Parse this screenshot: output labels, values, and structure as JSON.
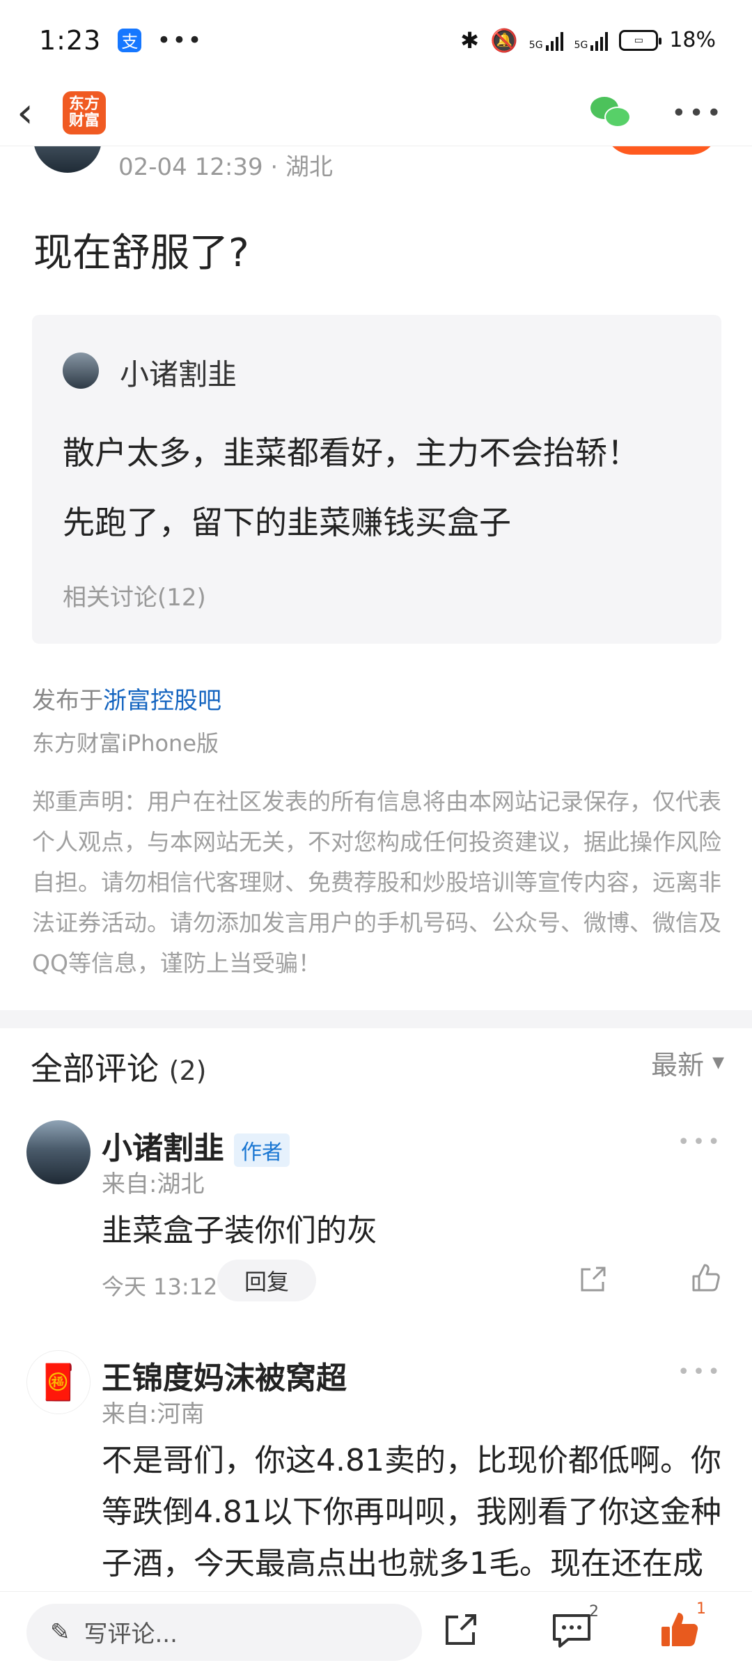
{
  "status_bar": {
    "time": "1:23",
    "alipay_icon": "支",
    "dots": "•••",
    "battery": "18%",
    "net_label_1": "5G",
    "net_label_2": "5G"
  },
  "nav": {
    "logo_text_top": "东方",
    "logo_text_bottom": "财富",
    "icons": [
      "back-icon",
      "wechat-icon",
      "more-icon"
    ]
  },
  "post": {
    "meta": "02-04 12:39 · 湖北",
    "title": "现在舒服了?",
    "quote": {
      "author": "小诸割韭",
      "line1": "散户太多，韭菜都看好，主力不会抬轿！",
      "line2": "先跑了，留下的韭菜赚钱买盒子",
      "related": "相关讨论(12)"
    },
    "publish_prefix": "发布于",
    "publish_link": "浙富控股吧",
    "client": "东方财富iPhone版",
    "disclaimer": "郑重声明：用户在社区发表的所有信息将由本网站记录保存，仅代表个人观点，与本网站无关，不对您构成任何投资建议，据此操作风险自担。请勿相信代客理财、免费荐股和炒股培训等宣传内容，远离非法证券活动。请勿添加发言用户的手机号码、公众号、微博、微信及QQ等信息，谨防上当受骗！"
  },
  "comments": {
    "title": "全部评论",
    "count": "(2)",
    "sort": "最新",
    "items": [
      {
        "name": "小诸割韭",
        "badge": "作者",
        "location": "来自:湖北",
        "text": "韭菜盒子装你们的灰",
        "time": "今天 13:12",
        "reply": "回复"
      },
      {
        "name": "王锦度妈沫被窝超",
        "location": "来自:河南",
        "text_l1": "不是哥们，你这4.81卖的，比现价都低啊。你",
        "text_l2": "等跌倒4.81以下你再叫呗，我刚看了你这金种",
        "text_l3": "子酒，今天最高点出也就多1毛。现在还在成"
      }
    ]
  },
  "bottom_bar": {
    "placeholder": "写评论...",
    "comment_count": "2",
    "like_count": "1"
  },
  "colors": {
    "brand": "#f05a22",
    "link": "#1565c0",
    "like_orange": "#e85a1e"
  }
}
